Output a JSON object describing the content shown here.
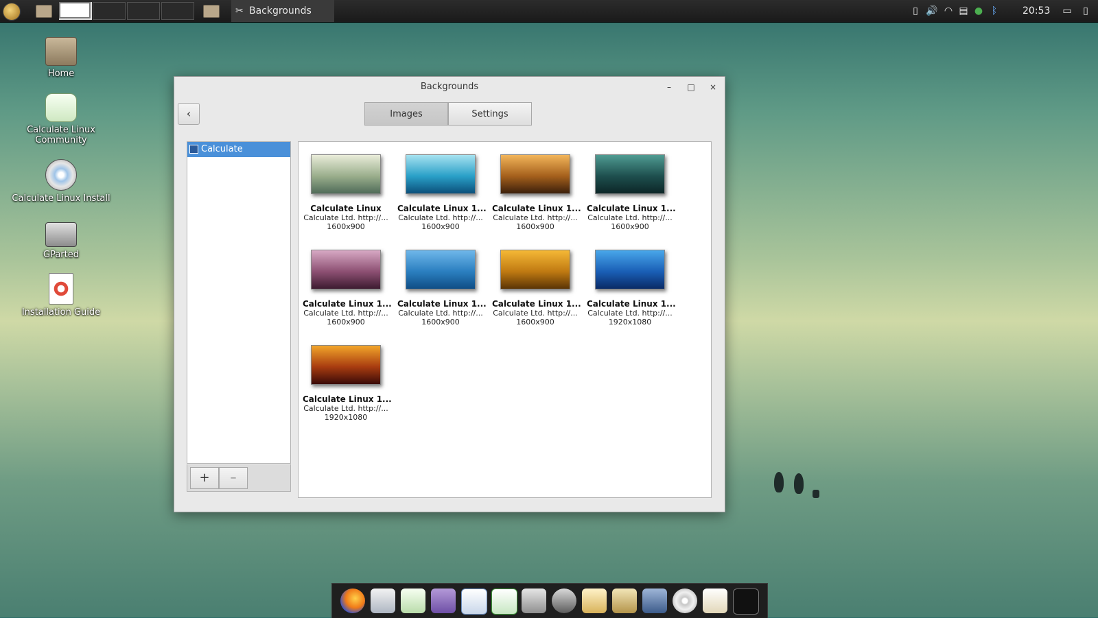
{
  "taskbar": {
    "active_task_label": "Backgrounds",
    "clock": "20:53"
  },
  "desktop": {
    "icons": [
      {
        "label": "Home"
      },
      {
        "label": "Calculate Linux Community"
      },
      {
        "label": "Calculate Linux Install"
      },
      {
        "label": "GParted"
      },
      {
        "label": "Installation Guide"
      }
    ]
  },
  "window": {
    "title": "Backgrounds",
    "back_label": "‹",
    "minimize_label": "–",
    "maximize_label": "□",
    "close_label": "×",
    "tabs": [
      {
        "label": "Images",
        "active": true
      },
      {
        "label": "Settings",
        "active": false
      }
    ],
    "sidebar": {
      "items": [
        {
          "label": "Calculate",
          "selected": true
        }
      ],
      "add_label": "+",
      "remove_label": "–"
    },
    "images": [
      {
        "name": "Calculate Linux",
        "author": "Calculate Ltd. http://...",
        "size": "1600x900",
        "colors": [
          "#e9ecd9",
          "#9aae8c",
          "#4f6b58"
        ]
      },
      {
        "name": "Calculate Linux 1...",
        "author": "Calculate Ltd. http://...",
        "size": "1600x900",
        "colors": [
          "#a6e2f0",
          "#2aa0c8",
          "#0b4f7a"
        ]
      },
      {
        "name": "Calculate Linux 1...",
        "author": "Calculate Ltd. http://...",
        "size": "1600x900",
        "colors": [
          "#f2b55a",
          "#a5601c",
          "#3b1f0b"
        ]
      },
      {
        "name": "Calculate Linux 1...",
        "author": "Calculate Ltd. http://...",
        "size": "1600x900",
        "colors": [
          "#4f9b92",
          "#1e4f4e",
          "#0c2627"
        ]
      },
      {
        "name": "Calculate Linux 1...",
        "author": "Calculate Ltd. http://...",
        "size": "1600x900",
        "colors": [
          "#d7a9c4",
          "#8d5073",
          "#3d1b30"
        ]
      },
      {
        "name": "Calculate Linux 1...",
        "author": "Calculate Ltd. http://...",
        "size": "1600x900",
        "colors": [
          "#6fb7ea",
          "#2b7fc0",
          "#0f4d85"
        ]
      },
      {
        "name": "Calculate Linux 1...",
        "author": "Calculate Ltd. http://...",
        "size": "1600x900",
        "colors": [
          "#f5b836",
          "#c07a12",
          "#5b3405"
        ]
      },
      {
        "name": "Calculate Linux 1...",
        "author": "Calculate Ltd. http://...",
        "size": "1920x1080",
        "colors": [
          "#49a7ea",
          "#1a5fb6",
          "#0a2a66"
        ]
      },
      {
        "name": "Calculate Linux 1...",
        "author": "Calculate Ltd. http://...",
        "size": "1920x1080",
        "colors": [
          "#f2a52a",
          "#a83c10",
          "#3a0a08"
        ]
      }
    ]
  }
}
